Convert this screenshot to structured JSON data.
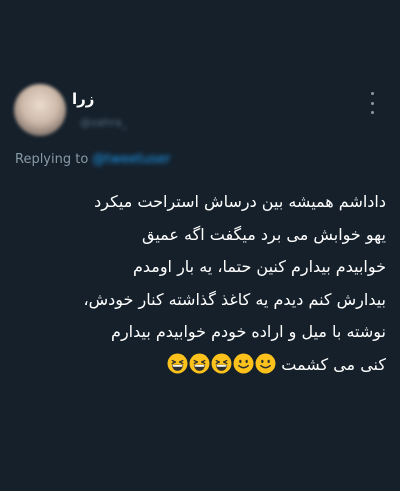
{
  "tweet": {
    "author_name": "زرا",
    "author_handle": "@zahra_",
    "replying_to_label": "Replying to",
    "replying_to_user": "@tweetuser",
    "body_lines": [
      "داداشم همیشه بین درساش استراحت میکرد",
      "یهو خوابش می برد میگفت اگه عمیق",
      "خوابیدم بیدارم کنین حتما، یه بار اومدم",
      "بیدارش کنم دیدم یه کاغذ گذاشته کنار خودش،",
      "نوشته با میل و اراده خودم خوابیدم بیدارم",
      "کنی می کشمت"
    ],
    "emojis": [
      "slightly-smiling-face-icon",
      "slightly-smiling-face-icon",
      "grinning-squinting-face-icon",
      "grinning-squinting-face-icon",
      "grinning-squinting-face-icon"
    ]
  },
  "colors": {
    "background": "#15202b",
    "text": "#ffffff",
    "secondary": "#8899a6",
    "link": "#1d9bf0"
  }
}
